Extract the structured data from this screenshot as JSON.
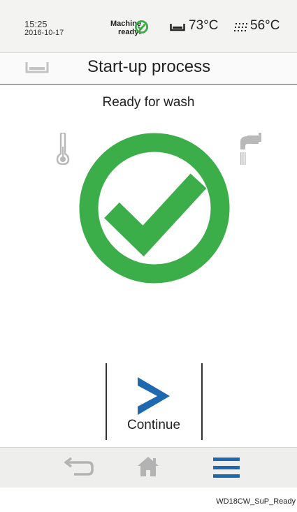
{
  "status_bar": {
    "time": "15:25",
    "date": "2016-10-17",
    "machine_status_line1": "Machine",
    "machine_status_line2": "ready!",
    "tub_temperature": "73°C",
    "water_temperature": "56°C"
  },
  "header": {
    "title": "Start-up process"
  },
  "main": {
    "status_text": "Ready for wash",
    "continue_label": "Continue"
  },
  "caption": "WD18CW_SuP_Ready",
  "colors": {
    "success_green": "#3cae49",
    "accent_blue": "#1e68b0",
    "icon_gray": "#b9b9b9"
  },
  "icons": {
    "status": "check-circle-icon",
    "tub": "tub-icon",
    "water": "shower-icon",
    "thermometer": "thermometer-icon",
    "tap": "tap-icon",
    "continue": "chevron-right-icon",
    "back": "back-arrow-icon",
    "home": "home-icon",
    "menu": "menu-icon"
  }
}
